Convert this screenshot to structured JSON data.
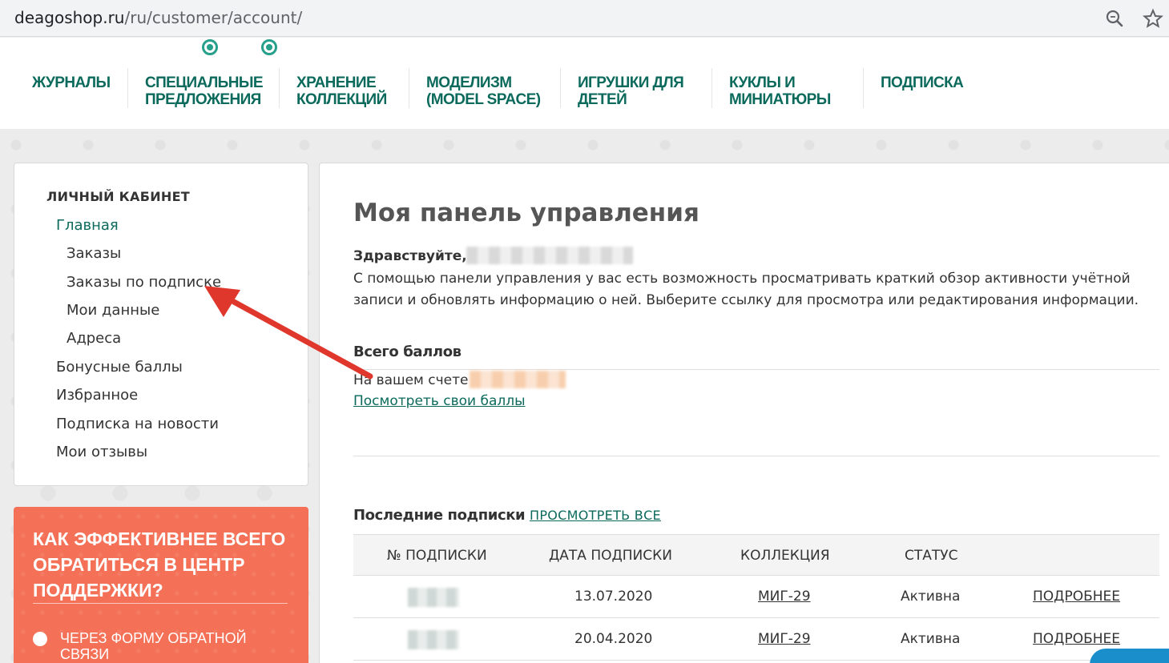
{
  "browser": {
    "url_host": "deagoshop.ru",
    "url_path": "/ru/customer/account/"
  },
  "topnav": {
    "items": [
      {
        "label": "ЖУРНАЛЫ"
      },
      {
        "label": "СПЕЦИАЛЬНЫЕ ПРЕДЛОЖЕНИЯ"
      },
      {
        "label": "ХРАНЕНИЕ КОЛЛЕКЦИЙ"
      },
      {
        "label": "МОДЕЛИЗМ (MODEL SPACE)"
      },
      {
        "label": "ИГРУШКИ ДЛЯ ДЕТЕЙ"
      },
      {
        "label": "КУКЛЫ И МИНИАТЮРЫ"
      },
      {
        "label": "ПОДПИСКА"
      }
    ]
  },
  "sidebar": {
    "title": "ЛИЧНЫЙ КАБИНЕТ",
    "items": [
      {
        "label": "Главная",
        "active": true
      },
      {
        "label": "Заказы"
      },
      {
        "label": "Заказы по подписке"
      },
      {
        "label": "Мои данные"
      },
      {
        "label": "Адреса"
      },
      {
        "label": "Бонусные баллы"
      },
      {
        "label": "Избранное"
      },
      {
        "label": "Подписка на новости"
      },
      {
        "label": "Мои отзывы"
      }
    ]
  },
  "support": {
    "title": "КАК ЭФФЕКТИВНЕЕ ВСЕГО ОБРАТИТЬСЯ В ЦЕНТР ПОДДЕРЖКИ?",
    "option": "ЧЕРЕЗ ФОРМУ ОБРАТНОЙ СВЯЗИ"
  },
  "main": {
    "title": "Моя панель управления",
    "greeting": "Здравствуйте,",
    "intro": "С помощью панели управления у вас есть возможность просматривать краткий обзор активности учётной записи и обновлять информацию о ней. Выберите ссылку для просмотра или редактирования информации.",
    "points": {
      "title": "Всего баллов",
      "label": "На вашем счете",
      "link": "Посмотреть свои баллы"
    },
    "subscriptions": {
      "title": "Последние подписки",
      "view_all": "ПРОСМОТРЕТЬ ВСЕ",
      "columns": [
        "№ ПОДПИСКИ",
        "ДАТА ПОДПИСКИ",
        "КОЛЛЕКЦИЯ",
        "СТАТУС"
      ],
      "rows": [
        {
          "date": "13.07.2020",
          "collection": "МИГ-29",
          "status": "Активна",
          "details": "ПОДРОБНЕЕ"
        },
        {
          "date": "20.04.2020",
          "collection": "МИГ-29",
          "status": "Активна",
          "details": "ПОДРОБНЕЕ"
        }
      ]
    }
  },
  "colors": {
    "brand": "#0b6a5c",
    "accent": "#26a08a",
    "support_bg": "#f47157",
    "arrow": "#e0372d"
  },
  "icons": [
    "zoom-icon",
    "star-icon",
    "arrow-annotation"
  ]
}
